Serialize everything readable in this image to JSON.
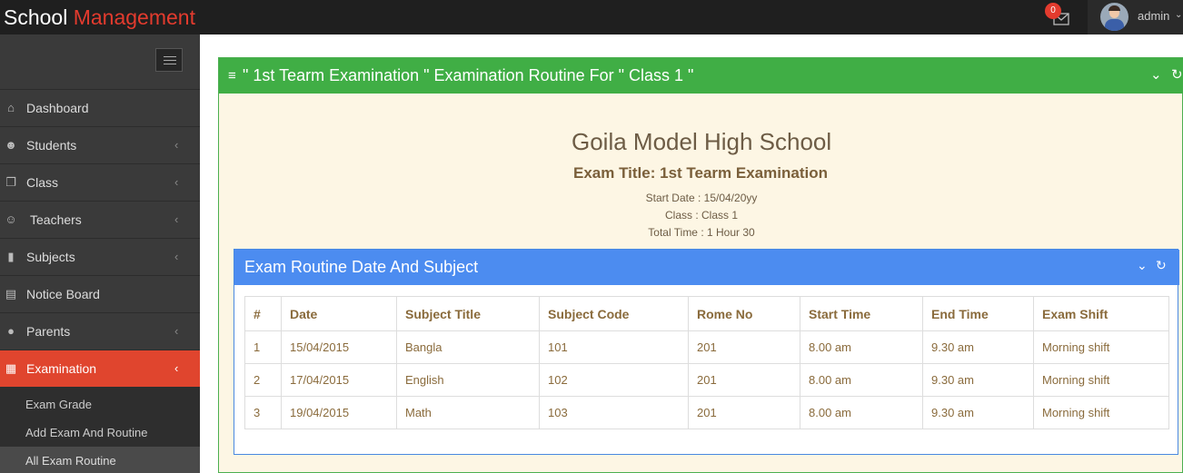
{
  "brand": {
    "part1": "School",
    "part2": "Management"
  },
  "topbar": {
    "notification_count": "0",
    "user": "admin"
  },
  "sidebar": {
    "items": [
      {
        "label": "Dashboard",
        "icon": "home-icon"
      },
      {
        "label": "Students",
        "icon": "users-icon"
      },
      {
        "label": "Class",
        "icon": "cubes-icon"
      },
      {
        "label": "Teachers",
        "icon": "teacher-icon"
      },
      {
        "label": "Subjects",
        "icon": "book-icon"
      },
      {
        "label": "Notice Board",
        "icon": "clipboard-icon"
      },
      {
        "label": "Parents",
        "icon": "user-icon"
      },
      {
        "label": "Examination",
        "icon": "table-icon"
      }
    ],
    "sub_items": [
      "Exam Grade",
      "Add Exam And Routine",
      "All Exam Routine"
    ]
  },
  "panel": {
    "title": "\" 1st Tearm Examination \" Examination Routine For \" Class 1 \"",
    "school": "Goila Model High School",
    "exam_title": "Exam Title: 1st Tearm Examination",
    "start_date": "Start Date : 15/04/20yy",
    "class": "Class : Class 1",
    "total_time": "Total Time : 1 Hour 30"
  },
  "routine": {
    "title": "Exam Routine Date And Subject",
    "columns": [
      "#",
      "Date",
      "Subject Title",
      "Subject Code",
      "Rome No",
      "Start Time",
      "End Time",
      "Exam Shift"
    ],
    "rows": [
      [
        "1",
        "15/04/2015",
        "Bangla",
        "101",
        "201",
        "8.00 am",
        "9.30 am",
        "Morning shift"
      ],
      [
        "2",
        "17/04/2015",
        "English",
        "102",
        "201",
        "8.00 am",
        "9.30 am",
        "Morning shift"
      ],
      [
        "3",
        "19/04/2015",
        "Math",
        "103",
        "201",
        "8.00 am",
        "9.30 am",
        "Morning shift"
      ]
    ]
  }
}
